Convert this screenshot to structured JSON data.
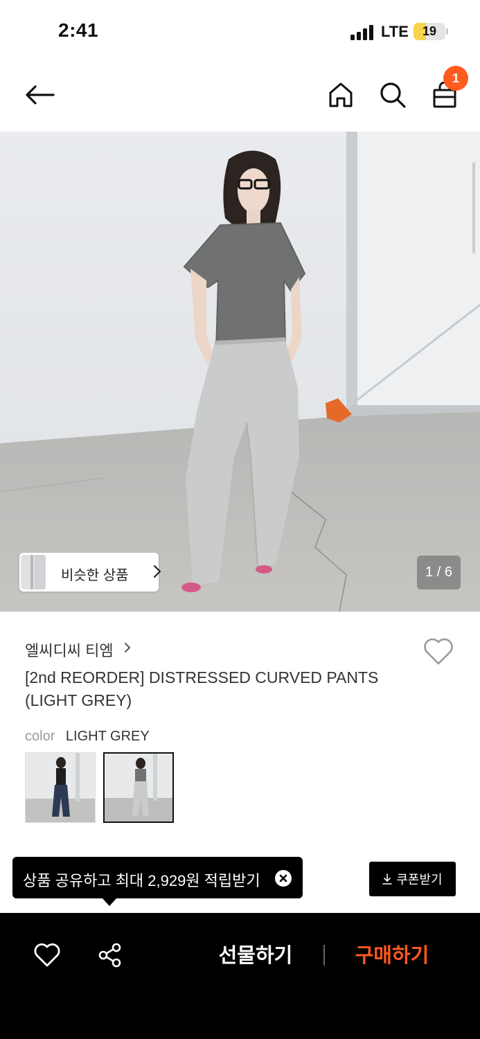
{
  "status_bar": {
    "time": "2:41",
    "network": "LTE",
    "battery_level": "19"
  },
  "top_nav": {
    "back_icon": "arrow-left-icon",
    "home_icon": "home-icon",
    "search_icon": "search-icon",
    "cart_icon": "shopping-bag-icon",
    "cart_count": "1"
  },
  "gallery": {
    "similar_products_label": "비슷한 상품",
    "current_page": "1 / 6"
  },
  "product": {
    "brand": "엘씨디씨 티엠",
    "title": "[2nd REORDER] DISTRESSED CURVED PANTS (LIGHT GREY)",
    "color_label": "color",
    "color_value": "LIGHT GREY",
    "swatches": [
      {
        "name": "black-top-navy-jeans"
      },
      {
        "name": "grey-tee-light-grey-pants",
        "selected": true
      }
    ]
  },
  "share_tooltip": {
    "text": "상품 공유하고 최대 2,929원 적립받기"
  },
  "coupon": {
    "label": "쿠폰받기"
  },
  "bottom_bar": {
    "gift_label": "선물하기",
    "buy_label": "구매하기"
  },
  "colors": {
    "accent": "#ff5a1f",
    "bar": "#000000",
    "badge": "#ff5a1f"
  }
}
